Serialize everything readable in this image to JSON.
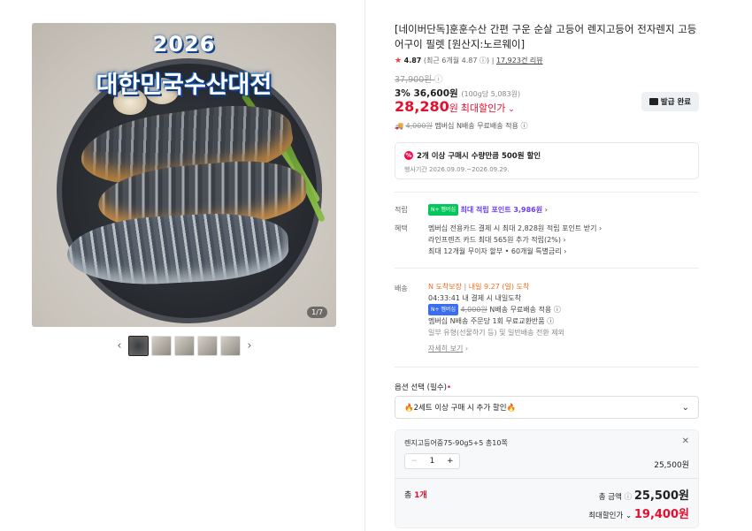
{
  "gallery": {
    "banner_year": "2026",
    "banner_title": "대한민국수산대전",
    "counter": "1/7",
    "prev_arrow": "‹",
    "next_arrow": "›",
    "thumb_count": 5
  },
  "product": {
    "title": "[네이버단독]훈훈수산 간편 구운 순살 고등어 렌지고등어 전자렌지 고등어구이 필렛 [원산지:노르웨이]",
    "rating": "4.87",
    "rating_detail": "(최근 6개월 4.87",
    "review_link": "17,923건 리뷰",
    "original_price": "37,900원",
    "discount_rate": "3%",
    "discount_price": "36,600원",
    "unit_price": "(100g당 5,083원)",
    "final_price": "28,280",
    "final_unit": "원",
    "final_label": "최대할인가",
    "coupon_button": "발급 완료",
    "shipping_old": "4,000원",
    "shipping_text": "멤버십 N배송 무료배송 적용"
  },
  "promo": {
    "title": "2개 이상 구매시 수량만큼 500원 할인",
    "period": "행사기간 2026.09.09.~2026.09.29."
  },
  "benefits": {
    "points_label": "적립",
    "points_badge": "N+ 멤버십",
    "points_text": "최대 적립 포인트 3,986원",
    "benefit_label": "혜택",
    "benefit_lines": [
      "멤버십 전용카드 결제 시 최대 2,828원 적립 포인트 받기",
      "라인프렌즈 카드 최대 565원 추가 적립(2%)",
      "최대 12개월 무이자 할부 • 60개월 특별금리"
    ]
  },
  "delivery": {
    "label": "배송",
    "badge": "N 도착보장",
    "eta": "내일 9.27 (일) 도착",
    "cutoff": "04:33:41  내 결제 시 내일도착",
    "n_badge": "N+ 멤버십",
    "n_old": "4,000원",
    "n_text": "N배송 무료배송 적용",
    "exchange": "멤버십 N배송 주문당 1회 무료교환반품",
    "note": "일부 유형(선물하기 등) 및 일반배송 전환 제외",
    "more_link": "자세히 보기"
  },
  "options": {
    "label": "옵션 선택 (필수)",
    "required_mark": "•",
    "select_text": "🔥2세트 이상 구매 시 추가 할인🔥",
    "item_name": "렌지고등어중75-90g5+5 총10쪽",
    "quantity": "1",
    "item_price": "25,500원",
    "total_label": "총",
    "total_count": "1개",
    "total_amount_label": "총 금액",
    "total_amount": "25,500원",
    "max_disc_label": "최대할인가",
    "max_disc_amount": "19,400원"
  }
}
